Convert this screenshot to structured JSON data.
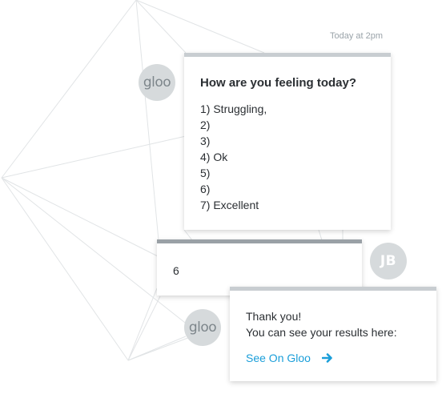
{
  "conversation": {
    "timestamp": "Today at 2pm",
    "bot_avatar_label": "gloo",
    "user_avatar_label": "JB",
    "question": {
      "title": "How are you feeling today?",
      "options": [
        "1) Struggling,",
        "2)",
        "3)",
        "4) Ok",
        "5)",
        "6)",
        "7) Excellent"
      ]
    },
    "answer": "6",
    "reply": {
      "line1": "Thank you!",
      "line2": "You can see your results here:",
      "link_label": "See On Gloo"
    }
  },
  "colors": {
    "link": "#1a9ed9",
    "avatar_bg": "#d6dadc",
    "card_accent": "#c8cdd1",
    "answer_accent": "#9aa1a6"
  },
  "icons": {
    "link_arrow": "arrow-right-icon"
  }
}
